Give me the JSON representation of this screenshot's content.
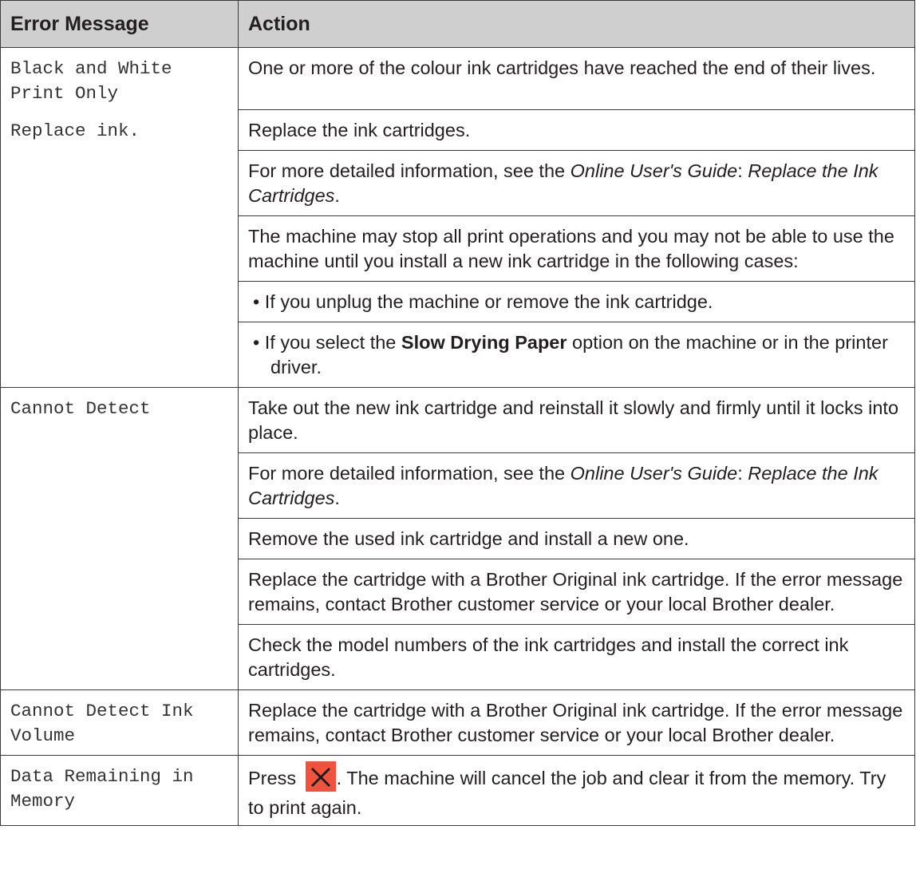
{
  "headers": {
    "error_message": "Error Message",
    "action": "Action"
  },
  "rows": {
    "bw": {
      "error": "Black and White Print Only",
      "error2": "Replace ink.",
      "a1": "One or more of the colour ink cartridges have reached the end of their lives.",
      "a2": "Replace the ink cartridges.",
      "a3_pre": "For more detailed information, see the ",
      "a3_guide": "Online User's Guide",
      "a3_sep": ": ",
      "a3_link": "Replace the Ink Cartridges",
      "a3_end": ".",
      "a4": "The machine may stop all print operations and you may not be able to use the machine until you install a new ink cartridge in the following cases:",
      "bullet1": "If you unplug the machine or remove the ink cartridge.",
      "bullet2_pre": "If you select the ",
      "bullet2_bold": "Slow Drying Paper",
      "bullet2_post": " option on the machine or in the printer driver."
    },
    "cd": {
      "error": "Cannot Detect",
      "a1": "Take out the new ink cartridge and reinstall it slowly and firmly until it locks into place.",
      "a2_pre": "For more detailed information, see the ",
      "a2_guide": "Online User's Guide",
      "a2_sep": ": ",
      "a2_link": "Replace the Ink Cartridges",
      "a2_end": ".",
      "a3": "Remove the used ink cartridge and install a new one.",
      "a4": "Replace the cartridge with a Brother Original ink cartridge. If the error message remains, contact Brother customer service or your local Brother dealer.",
      "a5": "Check the model numbers of the ink cartridges and install the correct ink cartridges."
    },
    "cdiv": {
      "error": "Cannot Detect Ink Volume",
      "a1": "Replace the cartridge with a Brother Original ink cartridge. If the error message remains, contact Brother customer service or your local Brother dealer."
    },
    "drm": {
      "error": "Data Remaining in Memory",
      "a1_pre": "Press ",
      "a1_post": ". The machine will cancel the job and clear it from the memory. Try to print again."
    },
    "bullet_char": "•"
  },
  "icons": {
    "stop": "stop-x-icon",
    "stop_color": "#f0533d"
  }
}
